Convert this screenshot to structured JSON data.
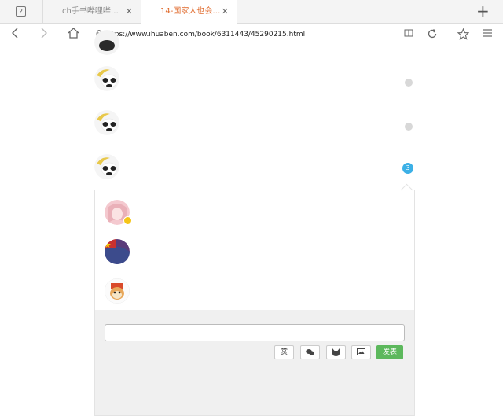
{
  "browser": {
    "tab_count": "2",
    "tabs": [
      {
        "title": "ch手书哔哩哔哩a..."
      },
      {
        "title": "14-国家人也会穿..."
      }
    ],
    "address": {
      "url": "https://www.ihuaben.com/book/6311443/45290215.html"
    }
  },
  "comments": {
    "unread_badge": "3"
  },
  "reply_box": {
    "input_value": "",
    "tools": [
      {
        "label": "赏"
      },
      {
        "label": "💬"
      },
      {
        "label": "🐱"
      },
      {
        "label": "🖼"
      }
    ],
    "send_label": "发表"
  },
  "colors": {
    "active_tab_text": "#e06a2c",
    "badge": "#3cb0e6",
    "send_button": "#5cb85c"
  }
}
